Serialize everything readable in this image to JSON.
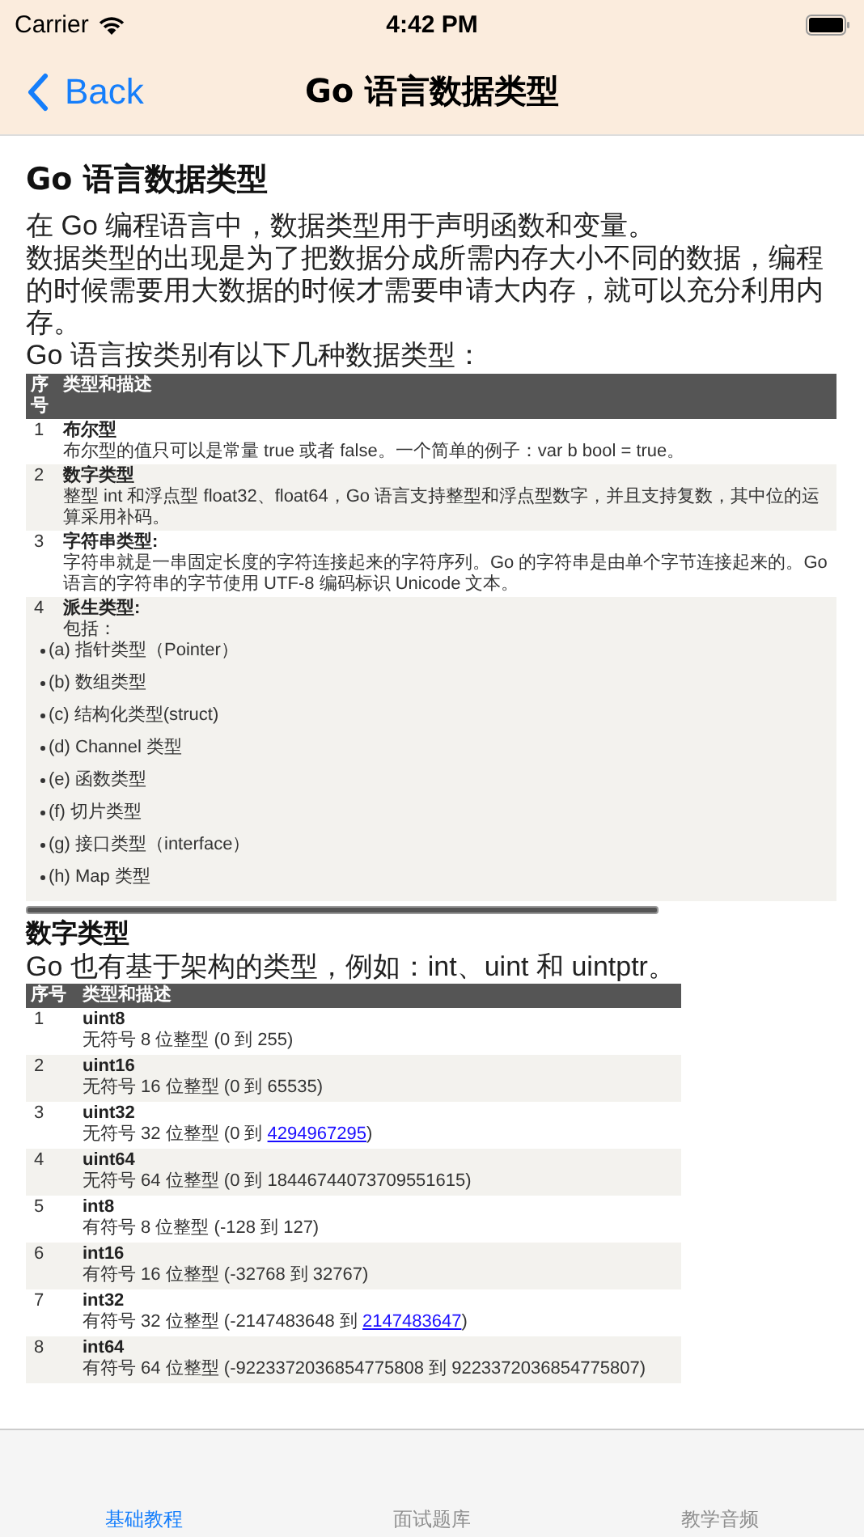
{
  "status_bar": {
    "carrier": "Carrier",
    "time": "4:42 PM"
  },
  "nav": {
    "back": "Back",
    "title": "Go 语言数据类型"
  },
  "article": {
    "heading": "Go 语言数据类型",
    "paragraphs": [
      "在 Go 编程语言中，数据类型用于声明函数和变量。",
      "数据类型的出现是为了把数据分成所需内存大小不同的数据，编程的时候需要用大数据的时候才需要申请大内存，就可以充分利用内存。",
      "Go 语言按类别有以下几种数据类型："
    ],
    "table": {
      "columns": [
        "序号",
        "类型和描述"
      ],
      "rows": [
        {
          "number": "1",
          "name": "布尔型",
          "description": "布尔型的值只可以是常量 true 或者 false。一个简单的例子：var b bool = true。"
        },
        {
          "number": "2",
          "name": "数字类型",
          "description": "整型 int 和浮点型 float32、float64，Go 语言支持整型和浮点型数字，并且支持复数，其中位的运算采用补码。"
        },
        {
          "number": "3",
          "name": "字符串类型:",
          "description": "字符串就是一串固定长度的字符连接起来的字符序列。Go 的字符串是由单个字节连接起来的。Go 语言的字符串的字节使用 UTF-8 编码标识 Unicode 文本。"
        },
        {
          "number": "4",
          "name": "派生类型:",
          "description": "包括：",
          "items": [
            "(a) 指针类型（Pointer）",
            "(b) 数组类型",
            "(c) 结构化类型(struct)",
            "(d) Channel 类型",
            "(e) 函数类型",
            "(f) 切片类型",
            "(g) 接口类型（interface）",
            "(h) Map 类型"
          ]
        }
      ]
    },
    "section_heading": "数字类型",
    "section_paragraph": "Go 也有基于架构的类型，例如：int、uint 和 uintptr。",
    "table2": {
      "columns": [
        "序号",
        "类型和描述"
      ],
      "rows": [
        {
          "number": "1",
          "name": "uint8",
          "description": "无符号 8 位整型 (0 到 255)"
        },
        {
          "number": "2",
          "name": "uint16",
          "description": "无符号 16 位整型 (0 到 65535)"
        },
        {
          "number": "3",
          "name": "uint32",
          "description": "无符号 32 位整型 (0 到 ",
          "link": "4294967295",
          "description_end": ")"
        },
        {
          "number": "4",
          "name": "uint64",
          "description": "无符号 64 位整型 (0 到 18446744073709551615)"
        },
        {
          "number": "5",
          "name": "int8",
          "description": "有符号 8 位整型 (-128 到 127)"
        },
        {
          "number": "6",
          "name": "int16",
          "description": "有符号 16 位整型 (-32768 到 32767)"
        },
        {
          "number": "7",
          "name": "int32",
          "description": "有符号 32 位整型 (-2147483648 到 ",
          "link": "2147483647",
          "description_end": ")"
        },
        {
          "number": "8",
          "name": "int64",
          "description": "有符号 64 位整型 (-9223372036854775808 到 9223372036854775807)"
        }
      ]
    }
  },
  "tab_bar": [
    {
      "label": "基础教程",
      "selected": true
    },
    {
      "label": "面试题库",
      "selected": false
    },
    {
      "label": "教学音频",
      "selected": false
    }
  ]
}
